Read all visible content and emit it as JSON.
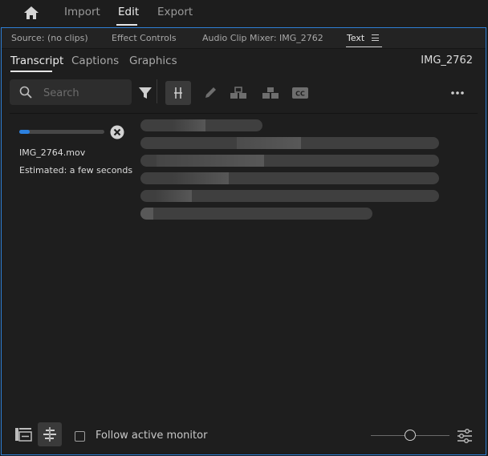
{
  "workspace": {
    "tabs": [
      {
        "label": "Import"
      },
      {
        "label": "Edit"
      },
      {
        "label": "Export"
      }
    ],
    "active_tab": "Edit"
  },
  "panel": {
    "tabs": [
      {
        "label": "Source: (no clips)"
      },
      {
        "label": "Effect Controls"
      },
      {
        "label": "Audio Clip Mixer: IMG_2762"
      },
      {
        "label": "Text"
      }
    ],
    "active_tab": "Text"
  },
  "text_panel": {
    "subtabs": [
      {
        "label": "Transcript"
      },
      {
        "label": "Captions"
      },
      {
        "label": "Graphics"
      }
    ],
    "active_subtab": "Transcript",
    "clip_name": "IMG_2762"
  },
  "toolbar": {
    "search_placeholder": "Search",
    "icons": [
      "search-icon",
      "filter-icon",
      "split-segment-icon",
      "pencil-icon",
      "merge-segments-icon",
      "split-segments-icon",
      "closed-captions-icon",
      "more-options-icon"
    ]
  },
  "transcription_job": {
    "file_name": "IMG_2764.mov",
    "status": "Estimated: a few seconds",
    "progress": 0.12
  },
  "footer": {
    "follow_label": "Follow active monitor",
    "follow_checked": false,
    "icons": [
      "transcript-view-icon",
      "paragraph-view-icon",
      "zoom-slider",
      "display-settings-icon"
    ]
  },
  "colors": {
    "accent": "#2c81e0",
    "panel_border": "#2e7ed4",
    "background": "#1d1d1d"
  }
}
